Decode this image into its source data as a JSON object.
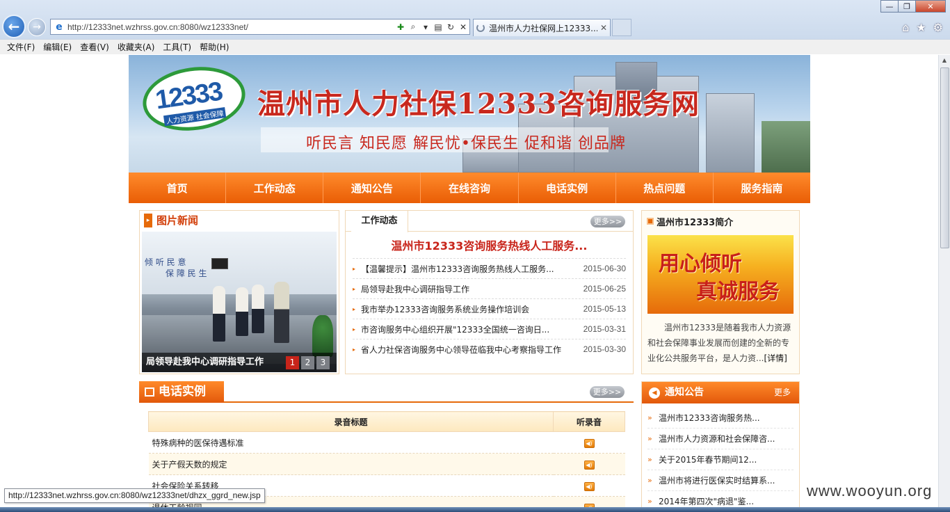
{
  "browser": {
    "url": "http://12333net.wzhrss.gov.cn:8080/wz12333net/",
    "tab_title": "温州市人力社保网上12333...",
    "menu": [
      "文件(F)",
      "编辑(E)",
      "查看(V)",
      "收藏夹(A)",
      "工具(T)",
      "帮助(H)"
    ],
    "status_url": "http://12333net.wzhrss.gov.cn:8080/wz12333net/dhzx_ggrd_new.jsp"
  },
  "banner": {
    "logo_number": "12333",
    "logo_tagline": "人力资源 社会保障",
    "title": "温州市人力社保12333咨询服务网",
    "slogan": "听民言 知民愿 解民忧•保民生 促和谐 创品牌"
  },
  "nav": [
    "首页",
    "工作动态",
    "通知公告",
    "在线咨询",
    "电话实例",
    "热点问题",
    "服务指南"
  ],
  "pic_news": {
    "title": "图片新闻",
    "wall_text_1": "倾 听 民 意",
    "wall_text_2": "保 障 民 生",
    "caption": "局领导赴我中心调研指导工作",
    "pages": [
      "1",
      "2",
      "3"
    ]
  },
  "work": {
    "tab": "工作动态",
    "more": "更多>>",
    "headline": "温州市12333咨询服务热线人工服务...",
    "items": [
      {
        "title": "【温馨提示】温州市12333咨询服务热线人工服务...",
        "date": "2015-06-30"
      },
      {
        "title": "局领导赴我中心调研指导工作",
        "date": "2015-06-25"
      },
      {
        "title": "我市举办12333咨询服务系统业务操作培训会",
        "date": "2015-05-13"
      },
      {
        "title": "市咨询服务中心组织开展\"12333全国统一咨询日...",
        "date": "2015-03-31"
      },
      {
        "title": "省人力社保咨询服务中心领导莅临我中心考察指导工作",
        "date": "2015-03-30"
      }
    ]
  },
  "intro": {
    "title": "温州市12333简介",
    "img_line1": "用心倾听",
    "img_line2": "真诚服务",
    "text": "温州市12333是随着我市人力资源和社会保障事业发展而创建的全新的专业化公共服务平台，是人力资...",
    "more": "[详情]"
  },
  "phone": {
    "title": "电话实例",
    "more": "更多>>",
    "col_title": "录音标题",
    "col_listen": "听录音",
    "rows": [
      "特殊病种的医保待遇标准",
      "关于产假天数的规定",
      "社会保险关系转移",
      "退休工龄视同"
    ]
  },
  "notice": {
    "title": "通知公告",
    "more": "更多",
    "items": [
      "温州市12333咨询服务热...",
      "温州市人力资源和社会保障咨...",
      "关于2015年春节期间12...",
      "温州市将进行医保实时结算系...",
      "2014年第四次\"病退\"鉴..."
    ]
  },
  "watermark": "www.wooyun.org"
}
